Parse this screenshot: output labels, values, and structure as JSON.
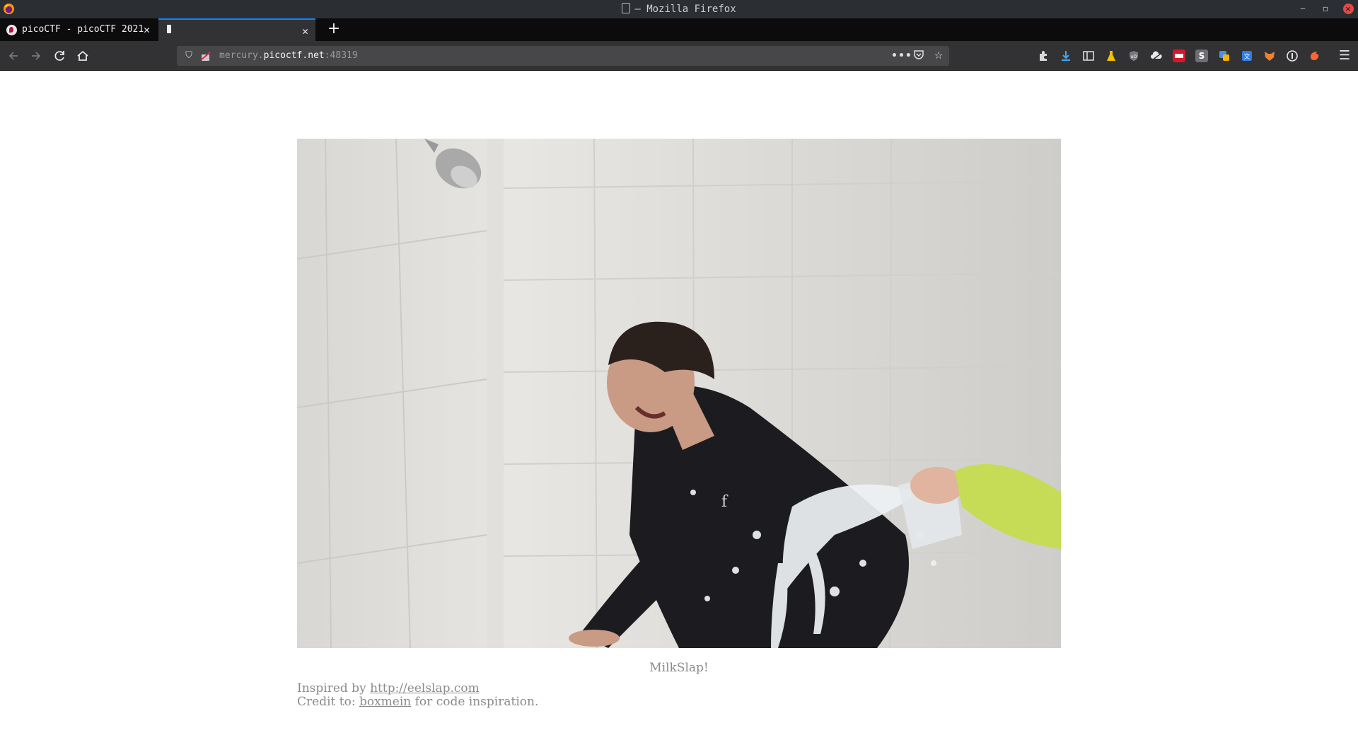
{
  "window": {
    "title": "— Mozilla Firefox"
  },
  "tabs": [
    {
      "label": "picoCTF - picoCTF 2021",
      "close": "✕"
    },
    {
      "label": "",
      "close": "✕"
    }
  ],
  "newtab": "+",
  "nav": {
    "url_prefix": "mercury.",
    "url_host": "picoctf.net",
    "url_port": ":48319"
  },
  "page": {
    "caption": "MilkSlap!",
    "inspired_prefix": "Inspired by ",
    "inspired_link": "http://eelslap.com",
    "credit_prefix": "Credit to: ",
    "credit_link": "boxmein",
    "credit_suffix": " for code inspiration."
  },
  "colors": {
    "titlebar": "#2b2e33",
    "tabstrip": "#0c0c0d",
    "navbar": "#323234",
    "accent": "#0a84ff"
  },
  "icons": {
    "extensions": [
      "puzzle-icon",
      "download-icon",
      "sidebar-icon",
      "flask-icon",
      "ublock-icon",
      "cloud-icon",
      "red-extension-icon",
      "s-extension-icon",
      "translate-icon",
      "wappalyzer-icon",
      "fox-icon",
      "onepassword-icon",
      "burp-icon"
    ]
  }
}
